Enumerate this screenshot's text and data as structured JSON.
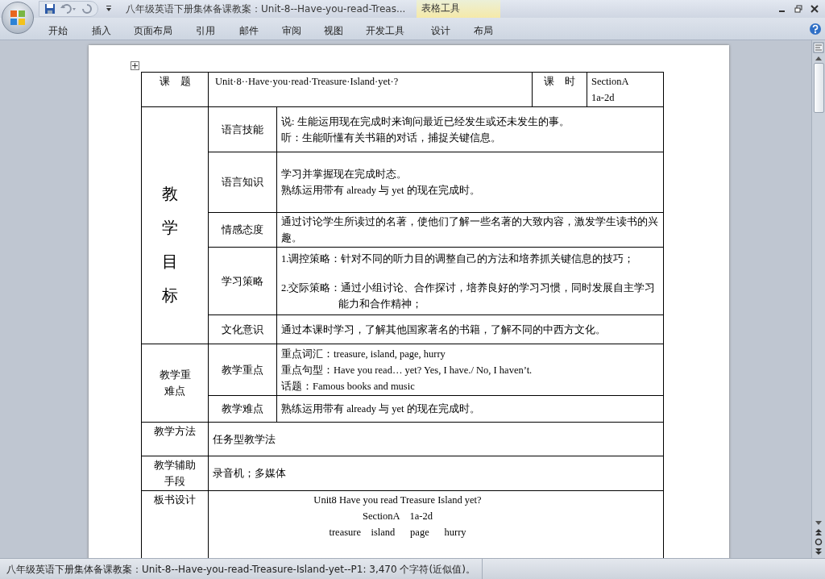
{
  "window": {
    "title": "八年级英语下册集体备课教案：Unit-8--Have-you-read-Treas..."
  },
  "contextual_tab_group": "表格工具",
  "ribbon_tabs": [
    "开始",
    "插入",
    "页面布局",
    "引用",
    "邮件",
    "审阅",
    "视图",
    "开发工具",
    "设计",
    "布局"
  ],
  "table": {
    "lesson": {
      "label": "课　题",
      "title": "Unit·8··Have·you·read·Treasure·Island·yet·?",
      "period_label": "课　时",
      "period": [
        "SectionA",
        "1a-2d"
      ]
    },
    "objectives": {
      "label": "教学目标",
      "rows": [
        {
          "label": "语言技能",
          "lines": [
            "说: 生能运用现在完成时来询问最近已经发生或还未发生的事。",
            "听：生能听懂有关书籍的对话，捕捉关键信息。"
          ]
        },
        {
          "label": "语言知识",
          "lines": [
            "学习并掌握现在完成时态。",
            "熟练运用带有 already 与 yet 的现在完成时。"
          ]
        },
        {
          "label": "情感态度",
          "lines": [
            "通过讨论学生所读过的名著，使他们了解一些名著的大致内容，激发学生读书的兴趣。"
          ]
        },
        {
          "label": "学习策略",
          "hanging_indent": true,
          "lines": [
            "1.调控策略：针对不同的听力目的调整自己的方法和培养抓关键信息的技巧；",
            "2.交际策略：通过小组讨论、合作探讨，培养良好的学习习惯，同时发展自主学习能力和合作精神；"
          ]
        },
        {
          "label": "文化意识",
          "lines": [
            "通过本课时学习，了解其他国家著名的书籍，了解不同的中西方文化。"
          ]
        }
      ]
    },
    "key_points": {
      "label": "教学重难点",
      "rows": [
        {
          "label": "教学重点",
          "lines": [
            "重点词汇：treasure, island, page, hurry",
            "重点句型：Have you read… yet? Yes, I have./ No, I haven’t.",
            "话题：Famous books and music"
          ]
        },
        {
          "label": "教学难点",
          "lines": [
            "熟练运用带有 already 与 yet 的现在完成时。"
          ]
        }
      ]
    },
    "other_rows": [
      {
        "label": "教学方法",
        "lines": [
          "任务型教学法"
        ]
      },
      {
        "label": "教学辅助手段",
        "lines": [
          "录音机；多媒体"
        ]
      },
      {
        "label": "板书设计",
        "lines": [
          "Unit8 Have you read Treasure Island yet?",
          "SectionA    1a-2d",
          "treasure    island      page      hurry"
        ]
      }
    ]
  },
  "status_bar": "八年级英语下册集体备课教案：Unit-8--Have-you-read-Treasure-Island-yet--P1: 3,470 个字符(近似值)。"
}
